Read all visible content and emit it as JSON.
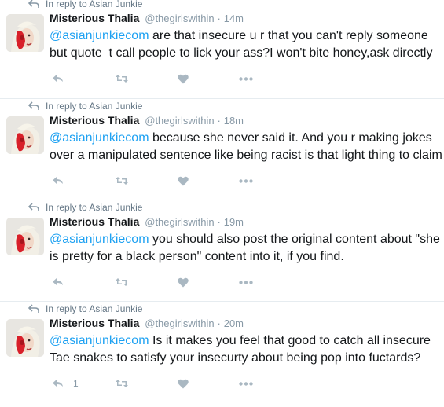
{
  "colors": {
    "mention": "#1da1f2",
    "muted": "#8899a6",
    "icon": "#aab8c2",
    "divider": "#e6ecf0"
  },
  "tweets": [
    {
      "context": "In reply to Asian Junkie",
      "name": "Misterious Thalia",
      "handle": "@thegirlswithin",
      "sep": "·",
      "time": "14m",
      "mention": "@asianjunkiecom",
      "text": " are that insecure u r that you can't reply someone\nbut quote  t call people to lick your ass?I won't bite honey,ask directly",
      "reply_count": ""
    },
    {
      "context": "In reply to Asian Junkie",
      "name": "Misterious Thalia",
      "handle": "@thegirlswithin",
      "sep": "·",
      "time": "18m",
      "mention": "@asianjunkiecom",
      "text": " because she never said it. And you r making jokes\nover a manipulated sentence like being racist is that light thing to claim",
      "reply_count": ""
    },
    {
      "context": "In reply to Asian Junkie",
      "name": "Misterious Thalia",
      "handle": "@thegirlswithin",
      "sep": "·",
      "time": "19m",
      "mention": "@asianjunkiecom",
      "text": " you should also post the original content about \"she\nis pretty for a black person\" content into it, if you find.",
      "reply_count": ""
    },
    {
      "context": "In reply to Asian Junkie",
      "name": "Misterious Thalia",
      "handle": "@thegirlswithin",
      "sep": "·",
      "time": "20m",
      "mention": "@asianjunkiecom",
      "text": " Is it makes you feel that good to catch all insecure\nTae snakes to satisfy your insecurty about being pop into fuctards?",
      "reply_count": "1"
    }
  ]
}
